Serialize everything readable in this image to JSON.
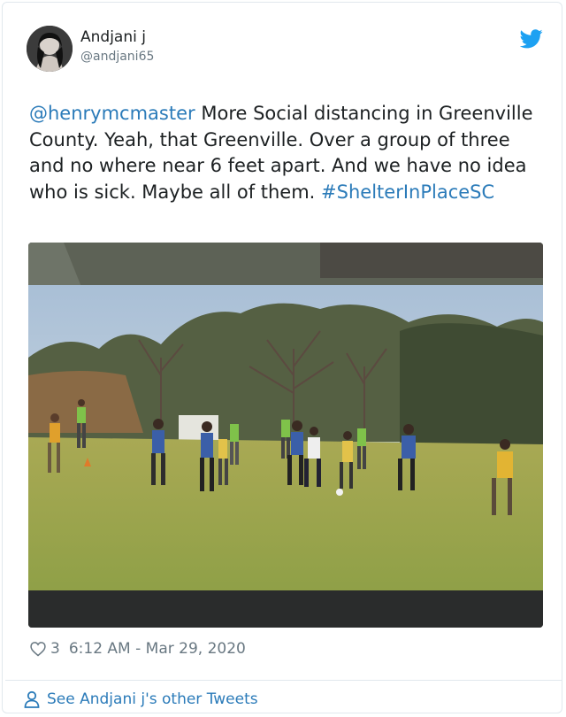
{
  "author": {
    "name": "Andjani j",
    "handle": "@andjani65"
  },
  "tweet": {
    "mention": "@henrymcmaster",
    "text": " More Social distancing in Greenville County. Yeah, that Greenville.  Over a group of three and no where near 6 feet apart. And we have no idea who is sick. Maybe all of them. ",
    "hashtag": "#ShelterInPlaceSC",
    "media_description": "Photo of people playing soccer on a grassy field"
  },
  "meta": {
    "likes": "3",
    "timestamp": "6:12 AM - Mar 29, 2020"
  },
  "footer": {
    "link_text": "See Andjani j's other Tweets"
  },
  "colors": {
    "link": "#2b7bb9",
    "muted": "#697882",
    "text": "#1c2022",
    "border": "#e1e8ed"
  },
  "icons": [
    "twitter-bird-icon",
    "heart-icon",
    "person-icon"
  ]
}
